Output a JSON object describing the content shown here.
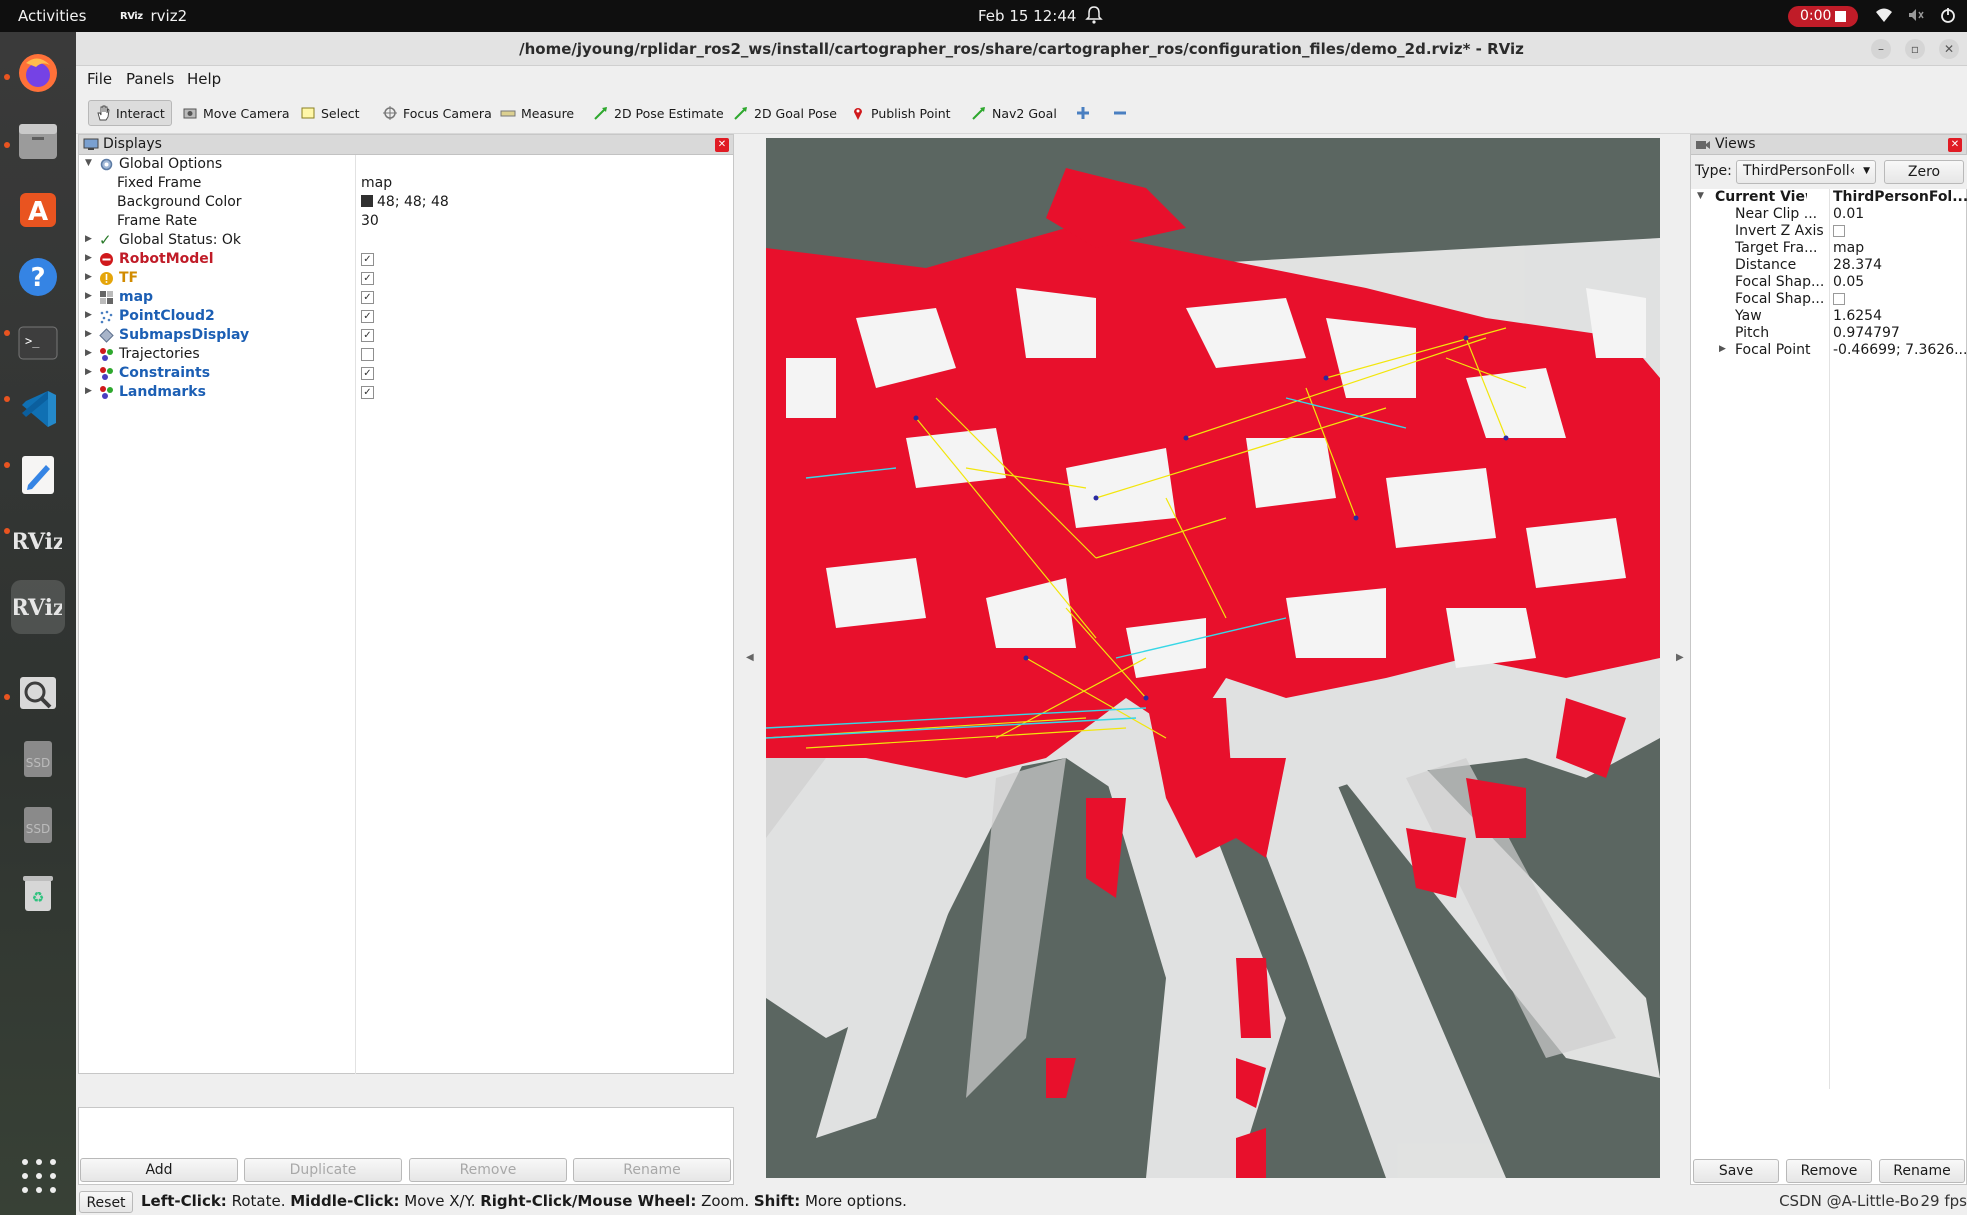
{
  "topbar": {
    "activities": "Activities",
    "app_name": "rviz2",
    "clock": "Feb 15  12:44",
    "recording": "0:00"
  },
  "window": {
    "title": "/home/jyoung/rplidar_ros2_ws/install/cartographer_ros/share/cartographer_ros/configuration_files/demo_2d.rviz* - RViz"
  },
  "menu": {
    "file": "File",
    "panels": "Panels",
    "help": "Help"
  },
  "toolbar": {
    "interact": "Interact",
    "move_camera": "Move Camera",
    "select": "Select",
    "focus_camera": "Focus Camera",
    "measure": "Measure",
    "pose_estimate": "2D Pose Estimate",
    "goal_pose": "2D Goal Pose",
    "publish_point": "Publish Point",
    "nav2_goal": "Nav2 Goal"
  },
  "displays": {
    "title": "Displays",
    "global_options": "Global Options",
    "fixed_frame_label": "Fixed Frame",
    "fixed_frame_value": "map",
    "bg_color_label": "Background Color",
    "bg_color_value": "48; 48; 48",
    "bg_color_swatch": "#303030",
    "frame_rate_label": "Frame Rate",
    "frame_rate_value": "30",
    "global_status": "Global Status: Ok",
    "items": [
      {
        "name": "RobotModel",
        "checked": true
      },
      {
        "name": "TF",
        "checked": true
      },
      {
        "name": "map",
        "checked": true
      },
      {
        "name": "PointCloud2",
        "checked": true
      },
      {
        "name": "SubmapsDisplay",
        "checked": true
      },
      {
        "name": "Trajectories",
        "checked": false
      },
      {
        "name": "Constraints",
        "checked": true
      },
      {
        "name": "Landmarks",
        "checked": true
      }
    ],
    "buttons": {
      "add": "Add",
      "duplicate": "Duplicate",
      "remove": "Remove",
      "rename": "Rename"
    }
  },
  "views": {
    "title": "Views",
    "type_label": "Type:",
    "type_value": "ThirdPersonFoll‹",
    "zero": "Zero",
    "current_view_label": "Current View",
    "current_view_value": "ThirdPersonFol...",
    "props": [
      {
        "name": "Near Clip ...",
        "value": "0.01"
      },
      {
        "name": "Invert Z Axis",
        "value": ""
      },
      {
        "name": "Target Fra...",
        "value": "map"
      },
      {
        "name": "Distance",
        "value": "28.374"
      },
      {
        "name": "Focal Shap...",
        "value": "0.05"
      },
      {
        "name": "Focal Shap...",
        "value": ""
      },
      {
        "name": "Yaw",
        "value": "1.6254"
      },
      {
        "name": "Pitch",
        "value": "0.974797"
      },
      {
        "name": "Focal Point",
        "value": "-0.46699; 7.3626..."
      }
    ],
    "buttons": {
      "save": "Save",
      "remove": "Remove",
      "rename": "Rename"
    }
  },
  "status": {
    "reset": "Reset",
    "hint_left": "Left-Click:",
    "hint_left_action": " Rotate. ",
    "hint_middle": "Middle-Click:",
    "hint_middle_action": " Move X/Y. ",
    "hint_right": "Right-Click/Mouse Wheel:",
    "hint_right_action": " Zoom. ",
    "hint_shift": "Shift:",
    "hint_shift_action": " More options.",
    "watermark": "CSDN @A-Little-Bo",
    "fps": "29 fps"
  },
  "colors": {
    "map_red": "#e8102c",
    "map_white": "#f4f4f4",
    "grid_bg": "#5b6661",
    "constraint_yellow": "#f2e60c",
    "constraint_cyan": "#37d7e6",
    "ubuntu_orange": "#e95420"
  }
}
